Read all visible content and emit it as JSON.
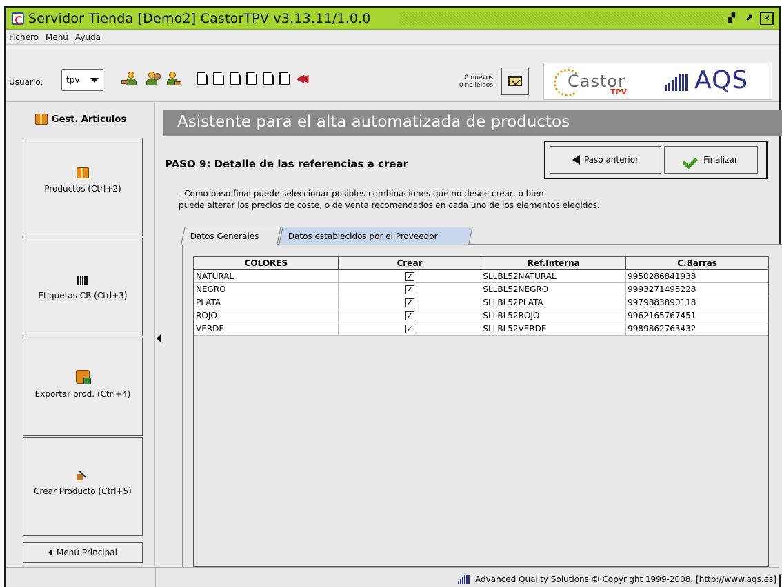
{
  "window": {
    "title": "Servidor Tienda  [Demo2] CastorTPV v3.13.11/1.0.0"
  },
  "menu": [
    "Fichero",
    "Menú",
    "Ayuda"
  ],
  "toolbar": {
    "user_label": "Usuario:",
    "user_value": "tpv",
    "messages_new": "0 nuevos",
    "messages_unread": "0 no leidos",
    "logo_castor": "Castor",
    "logo_castor_tpv": "TPV",
    "logo_aqs": "AQS"
  },
  "sidebar": {
    "header": "Gest. Articulos",
    "items": [
      {
        "label": "Productos (Ctrl+2)",
        "icon": "box-icon"
      },
      {
        "label": "Etiquetas CB (Ctrl+3)",
        "icon": "barcode-icon"
      },
      {
        "label": "Exportar prod. (Ctrl+4)",
        "icon": "export-icon"
      },
      {
        "label": "Crear Producto (Ctrl+5)",
        "icon": "wand-icon"
      }
    ],
    "main_menu": "Menú Principal"
  },
  "main": {
    "banner": "Asistente para el alta automatizada de productos",
    "step_title": "PASO 9: Detalle de las referencias a crear",
    "btn_prev": "Paso anterior",
    "btn_finish": "Finalizar",
    "desc_line1": "- Como paso final puede seleccionar posibles combinaciones que no desee crear, o bien",
    "desc_line2": "puede alterar los precios de coste, o de venta recomendados en cada uno de los elementos elegidos.",
    "tabs": [
      "Datos Generales",
      "Datos establecidos por el Proveedor"
    ]
  },
  "grid": {
    "columns": [
      "COLORES",
      "Crear",
      "Ref.Interna",
      "C.Barras"
    ],
    "rows": [
      [
        "NATURAL",
        "✓",
        "SLLBL52NATURAL",
        "9950286841938"
      ],
      [
        "NEGRO",
        "✓",
        "SLLBL52NEGRO",
        "9993271495228"
      ],
      [
        "PLATA",
        "✓",
        "SLLBL52PLATA",
        "9979883890118"
      ],
      [
        "ROJO",
        "✓",
        "SLLBL52ROJO",
        "9962165767451"
      ],
      [
        "VERDE",
        "✓",
        "SLLBL52VERDE",
        "9989862763432"
      ]
    ]
  },
  "status": {
    "text": "Advanced Quality Solutions © Copyright 1999-2008. [http://www.aqs.es]"
  },
  "colors": {
    "titlebar": "#a6d432",
    "banner": "#8a8a8a",
    "aqs_blue": "#2a2f8a"
  }
}
